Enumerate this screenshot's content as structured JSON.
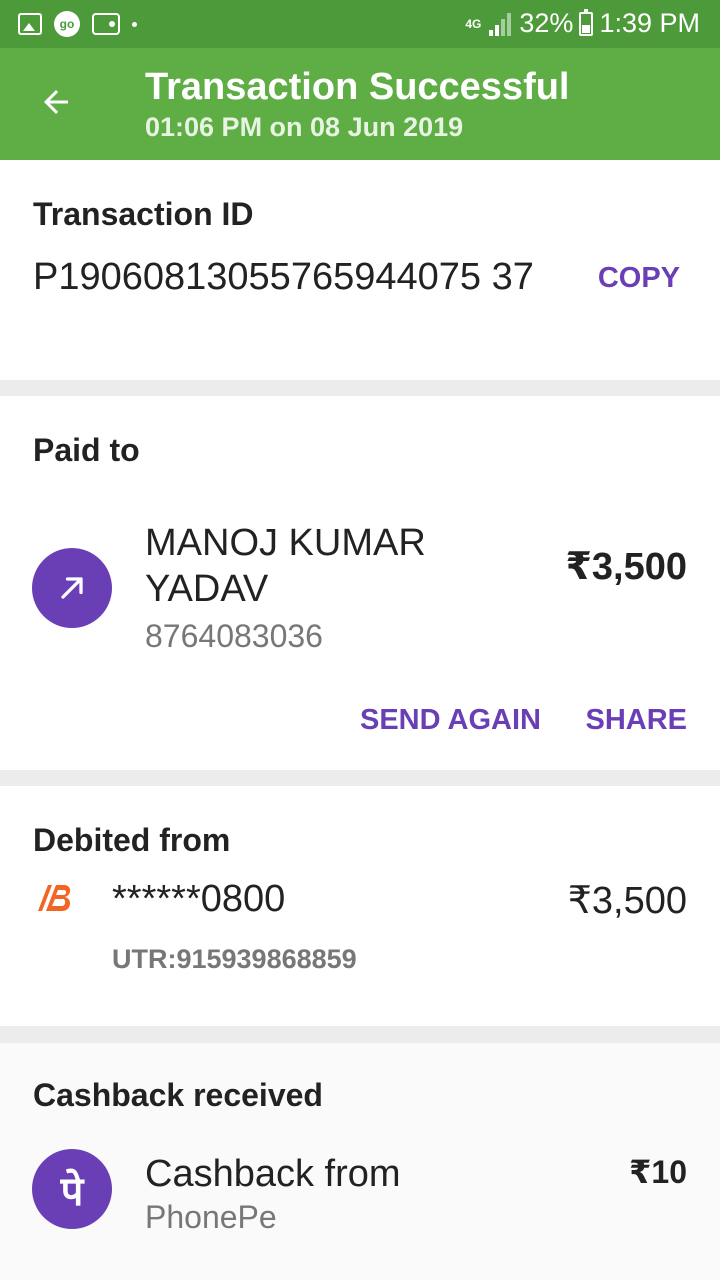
{
  "status_bar": {
    "left_icons": [
      "image-icon",
      "go-icon",
      "wallet-icon",
      "dot-icon"
    ],
    "network": "4G",
    "battery": "32%",
    "time": "1:39 PM"
  },
  "header": {
    "title": "Transaction Successful",
    "subtitle": "01:06 PM on 08 Jun 2019",
    "back_icon": "arrow-left-icon"
  },
  "transaction": {
    "label": "Transaction ID",
    "id": "P19060813055765944075 37",
    "copy_label": "COPY"
  },
  "paid_to": {
    "label": "Paid to",
    "name": "MANOJ KUMAR YADAV",
    "phone": "8764083036",
    "amount": "₹3,500",
    "icon": "arrow-up-right-icon",
    "send_again_label": "SEND AGAIN",
    "share_label": "SHARE"
  },
  "debited_from": {
    "label": "Debited from",
    "bank_icon": "bank-of-baroda-logo",
    "account": "******0800",
    "amount": "₹3,500",
    "utr": "UTR:915939868859"
  },
  "cashback": {
    "label": "Cashback received",
    "icon_glyph": "पे",
    "title": "Cashback from",
    "source": "PhonePe",
    "amount": "₹10"
  },
  "colors": {
    "status_bar": "#4d9a3a",
    "app_bar": "#5fad45",
    "accent": "#6a3fb5",
    "bank_logo": "#f26522"
  }
}
